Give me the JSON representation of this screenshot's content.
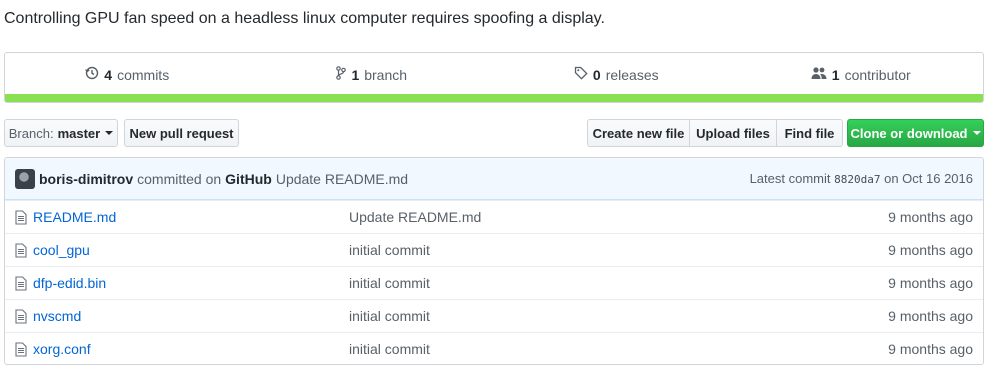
{
  "repo": {
    "description": "Controlling GPU fan speed on a headless linux computer requires spoofing a display."
  },
  "summary": {
    "commits_count": "4",
    "commits_label": "commits",
    "branch_count": "1",
    "branch_label": "branch",
    "releases_count": "0",
    "releases_label": "releases",
    "contributor_count": "1",
    "contributor_label": "contributor"
  },
  "language_bar_color": "#89e051",
  "toolbar": {
    "branch_prefix": "Branch:",
    "branch_name": "master",
    "new_pull_request": "New pull request",
    "create_new_file": "Create new file",
    "upload_files": "Upload files",
    "find_file": "Find file",
    "clone_or_download": "Clone or download"
  },
  "latest_commit": {
    "author": "boris-dimitrov",
    "committed_on": "committed on",
    "platform": "GitHub",
    "message": "Update README.md",
    "label": "Latest commit",
    "sha": "8820da7",
    "date": "on Oct 16 2016"
  },
  "files": [
    {
      "name": "README.md",
      "message": "Update README.md",
      "age": "9 months ago"
    },
    {
      "name": "cool_gpu",
      "message": "initial commit",
      "age": "9 months ago"
    },
    {
      "name": "dfp-edid.bin",
      "message": "initial commit",
      "age": "9 months ago"
    },
    {
      "name": "nvscmd",
      "message": "initial commit",
      "age": "9 months ago"
    },
    {
      "name": "xorg.conf",
      "message": "initial commit",
      "age": "9 months ago"
    }
  ],
  "colors": {
    "link": "#0366d6",
    "green_button": "#28a745",
    "commit_bg": "#f1f8ff"
  }
}
